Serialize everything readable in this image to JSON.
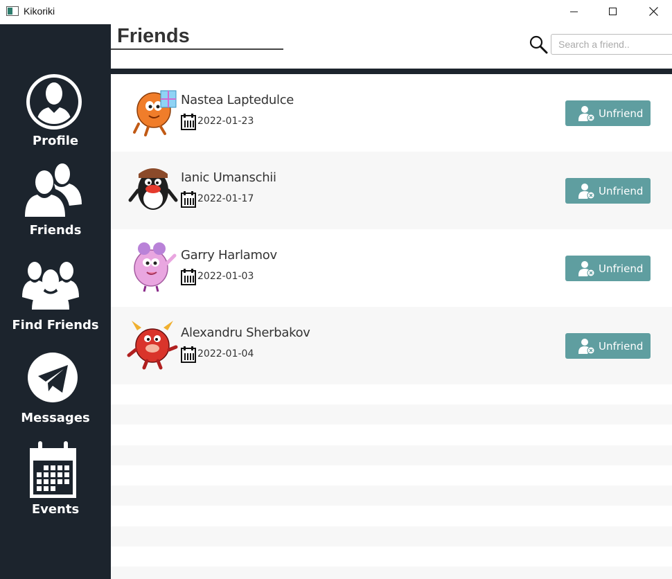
{
  "window": {
    "title": "Kikoriki",
    "controls": [
      "minimize-icon",
      "maximize-icon",
      "close-icon"
    ]
  },
  "sidebar": {
    "items": [
      {
        "label": "Profile",
        "icon": "user-icon"
      },
      {
        "label": "Friends",
        "icon": "two-users-icon"
      },
      {
        "label": "Find Friends",
        "icon": "three-users-icon"
      },
      {
        "label": "Messages",
        "icon": "paper-plane-icon"
      },
      {
        "label": "Events",
        "icon": "calendar-icon"
      }
    ]
  },
  "header": {
    "title": "Friends",
    "search": {
      "placeholder": "Search a friend..",
      "value": ""
    }
  },
  "friends": [
    {
      "name": "Nastea Laptedulce",
      "date": "2022-01-23",
      "button": "Unfriend",
      "avatar_color": "#f07d2a"
    },
    {
      "name": "Ianic Umanschii",
      "date": "2022-01-17",
      "button": "Unfriend",
      "avatar_color": "#222222"
    },
    {
      "name": "Garry Harlamov",
      "date": "2022-01-03",
      "button": "Unfriend",
      "avatar_color": "#e9a6e0"
    },
    {
      "name": "Alexandru Sherbakov",
      "date": "2022-01-04",
      "button": "Unfriend",
      "avatar_color": "#d9342b"
    }
  ],
  "colors": {
    "sidebar": "#1c242d",
    "accent_button": "#5f9ea0",
    "row_alt": "#f7f7f7"
  }
}
